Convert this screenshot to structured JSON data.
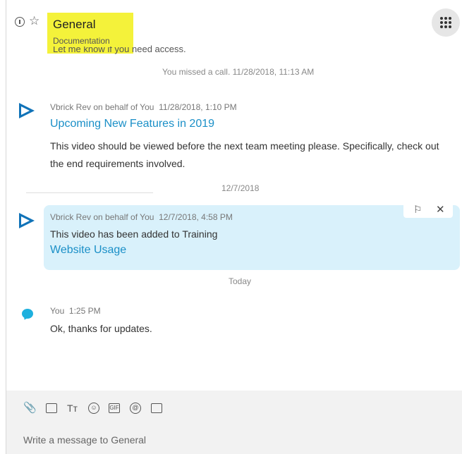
{
  "header": {
    "title": "General",
    "subtitle": "Documentation",
    "partial_message": "Let me know if you need access."
  },
  "messages": {
    "missed_call": "You missed a call. 11/28/2018, 11:13 AM",
    "msg1": {
      "sender": "Vbrick Rev on behalf of You",
      "time": "11/28/2018, 1:10 PM",
      "link": "Upcoming New Features in 2019",
      "line1": "This video should be viewed before the next team meeting please.  Specifically, check out",
      "line2": "the end requirements involved."
    },
    "date_sep_1": "12/7/2018",
    "msg2": {
      "sender": "Vbrick Rev on behalf of You",
      "time": "12/7/2018, 4:58 PM",
      "text": "This video has been added to Training",
      "link": "Website Usage"
    },
    "date_sep_2": "Today",
    "msg3": {
      "sender": "You",
      "time": "1:25 PM",
      "text": "Ok, thanks for updates."
    }
  },
  "composer": {
    "placeholder": "Write a message to General",
    "tools": [
      "attach-icon",
      "screenshot-icon",
      "text-format-icon",
      "emoji-icon",
      "gif-icon",
      "mention-icon",
      "contact-icon"
    ]
  },
  "colors": {
    "highlight": "#f4f23a",
    "link": "#1a8fc7",
    "card_bg": "#d9f1fb",
    "accent": "#1173b8"
  }
}
